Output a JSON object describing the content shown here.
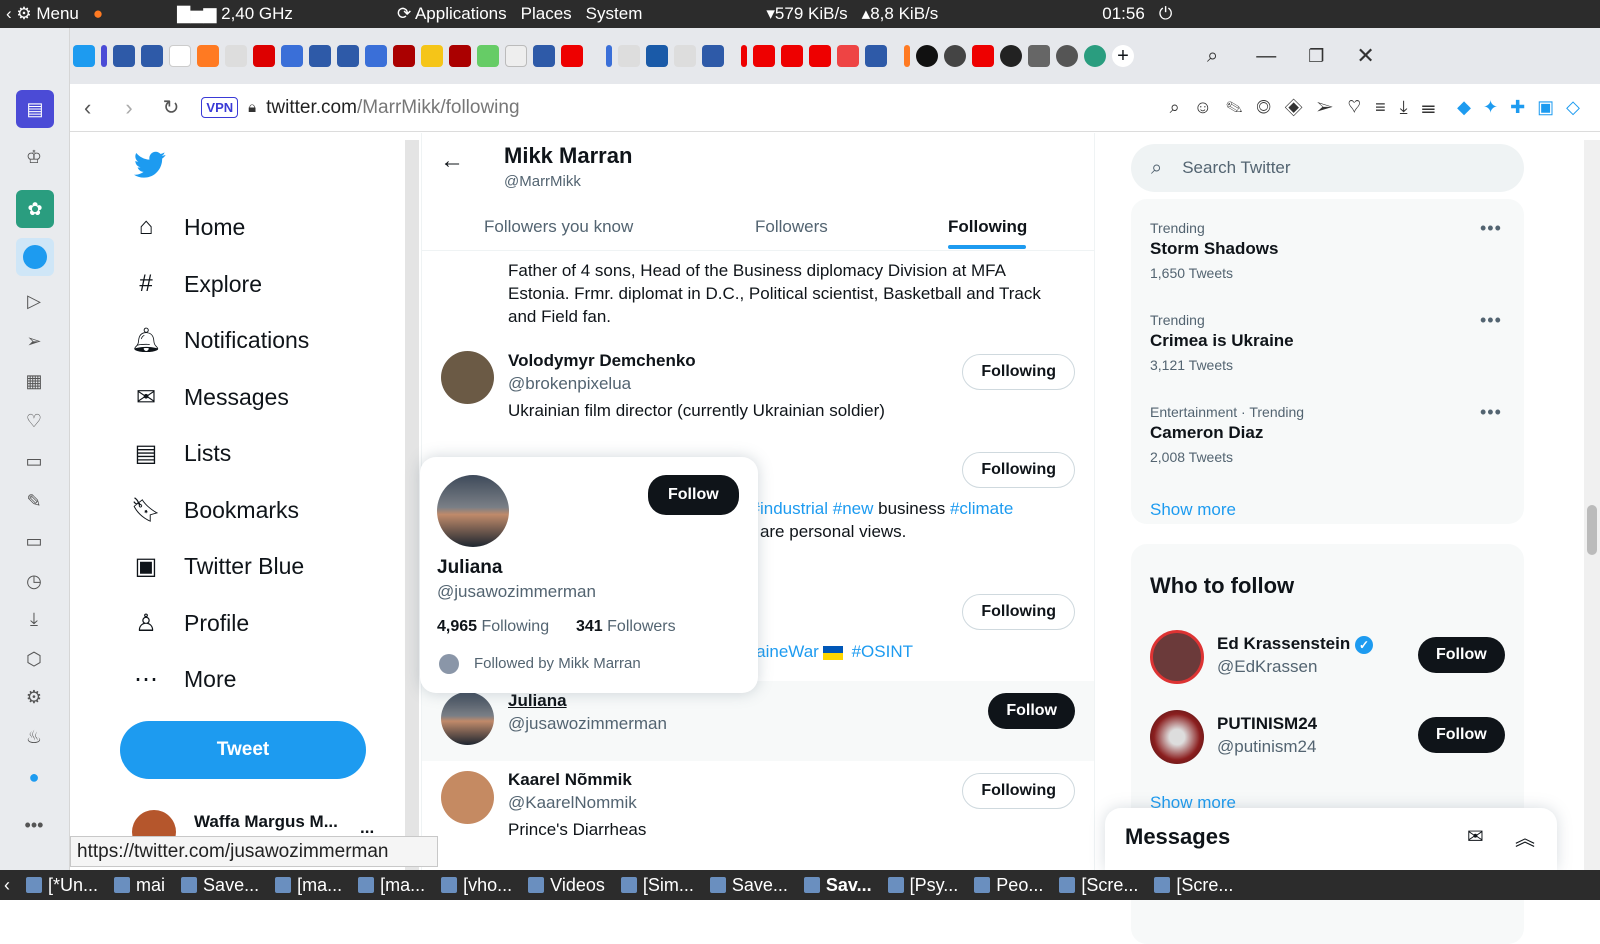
{
  "system_bar": {
    "menu": "Menu",
    "cpu": "2,40 GHz",
    "applications": "Applications",
    "places": "Places",
    "system": "System",
    "net_down": "579 KiB/s",
    "net_up": "8,8 KiB/s",
    "clock": "01:56"
  },
  "address_bar": {
    "vpn": "VPN",
    "url_domain": "twitter.com",
    "url_path": "/MarrMikk/following"
  },
  "leftnav": {
    "items": [
      {
        "label": "Home",
        "icon": "home-icon"
      },
      {
        "label": "Explore",
        "icon": "hash-icon"
      },
      {
        "label": "Notifications",
        "icon": "bell-icon"
      },
      {
        "label": "Messages",
        "icon": "envelope-icon"
      },
      {
        "label": "Lists",
        "icon": "list-icon"
      },
      {
        "label": "Bookmarks",
        "icon": "bookmark-icon"
      },
      {
        "label": "Twitter Blue",
        "icon": "twitter-blue-icon"
      },
      {
        "label": "Profile",
        "icon": "person-icon"
      },
      {
        "label": "More",
        "icon": "more-circle-icon"
      }
    ],
    "tweet_label": "Tweet",
    "account_name": "Waffa Margus M...",
    "account_more": "..."
  },
  "profile_header": {
    "name": "Mikk Marran",
    "handle": "@MarrMikk"
  },
  "tabs": [
    {
      "label": "Followers you know"
    },
    {
      "label": "Followers"
    },
    {
      "label": "Following"
    }
  ],
  "users": [
    {
      "bio": "Father of 4 sons, Head of the Business diplomacy Division at MFA Estonia. Frmr. diplomat in D.C., Political scientist, Basketball and Track and Field fan."
    },
    {
      "name": "Volodymyr Demchenko",
      "handle": "@brokenpixelua",
      "bio": "Ukrainian film director (currently Ukrainian soldier)",
      "button": "Following"
    },
    {
      "button": "Following",
      "bio_tags": [
        "l",
        "#industrial",
        "#new"
      ],
      "bio_word": "business",
      "bio_tag2": "#climate",
      "bio_line2": "ts are personal views."
    },
    {
      "button": "Following",
      "bio_tail": "kraineWar",
      "bio_tag": "#OSINT"
    },
    {
      "name": "Juliana",
      "handle": "@jusawozimmerman",
      "button": "Follow"
    },
    {
      "name": "Kaarel Nõmmik",
      "handle": "@KaarelNommik",
      "bio": "Prince's Diarrheas",
      "button": "Following"
    }
  ],
  "hovercard": {
    "name": "Juliana",
    "handle": "@jusawozimmerman",
    "following_count": "4,965",
    "following_label": "Following",
    "followers_count": "341",
    "followers_label": "Followers",
    "followed_by": "Followed by Mikk Marran",
    "button": "Follow"
  },
  "right": {
    "search_placeholder": "Search Twitter",
    "trends": [
      {
        "meta": "Trending",
        "title": "Storm Shadows",
        "count": "1,650 Tweets"
      },
      {
        "meta": "Trending",
        "title": "Crimea is Ukraine",
        "count": "3,121 Tweets"
      },
      {
        "meta": "Entertainment · Trending",
        "title": "Cameron Diaz",
        "count": "2,008 Tweets"
      }
    ],
    "show_more": "Show more",
    "who_to_follow": "Who to follow",
    "suggestions": [
      {
        "name": "Ed Krassenstein",
        "handle": "@EdKrassen",
        "button": "Follow"
      },
      {
        "name": "PUTINISM24",
        "handle": "@putinism24",
        "button": "Follow"
      }
    ],
    "show_more2": "Show more",
    "messages": "Messages"
  },
  "status_url": "https://twitter.com/jusawozimmerman",
  "taskbar": {
    "items": [
      "[*Un...",
      "mai",
      "Save...",
      "[ma...",
      "[ma...",
      "[vho...",
      "Videos",
      "[Sim...",
      "Save...",
      "Sav...",
      "[Psy...",
      "Peo...",
      "[Scre...",
      "[Scre..."
    ]
  },
  "colors": {
    "accent": "#1d9bf0",
    "text": "#0f1419",
    "muted": "#536471"
  }
}
